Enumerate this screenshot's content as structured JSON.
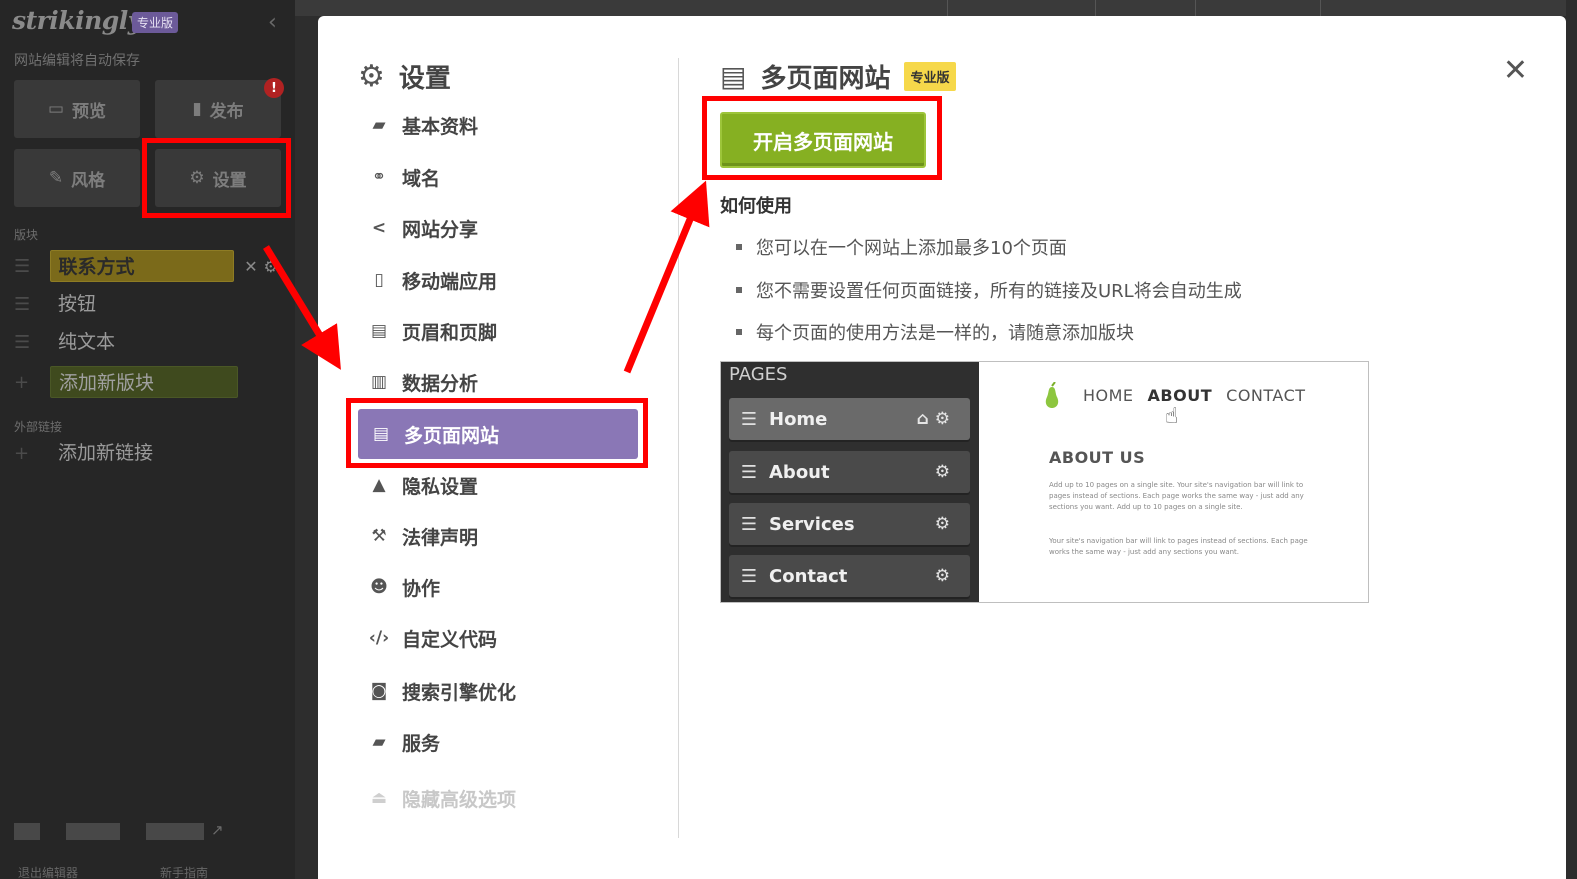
{
  "sidebar": {
    "logo": "strikingly",
    "pro_badge": "专业版",
    "autosave": "网站编辑将自动保存",
    "buttons": {
      "preview": "预览",
      "publish": "发布",
      "style": "风格",
      "settings": "设置"
    },
    "publish_alert": "!",
    "sections": {
      "blocks": "版块",
      "external_links": "外部链接"
    },
    "blocks": [
      "联系方式",
      "按钮",
      "纯文本"
    ],
    "add_block": "添加新版块",
    "add_link": "添加新链接",
    "footer": {
      "exit_editor": "退出编辑器",
      "guide": "新手指南"
    }
  },
  "modal": {
    "nav_title": "设置",
    "nav_items": [
      {
        "label": "基本资料",
        "icon": "briefcase-icon"
      },
      {
        "label": "域名",
        "icon": "link-icon"
      },
      {
        "label": "网站分享",
        "icon": "share-icon"
      },
      {
        "label": "移动端应用",
        "icon": "mobile-icon"
      },
      {
        "label": "页眉和页脚",
        "icon": "header-footer-icon"
      },
      {
        "label": "数据分析",
        "icon": "bar-chart-icon"
      },
      {
        "label": "多页面网站",
        "icon": "pages-icon"
      },
      {
        "label": "隐私设置",
        "icon": "lock-icon"
      },
      {
        "label": "法律声明",
        "icon": "gavel-icon"
      },
      {
        "label": "协作",
        "icon": "users-icon"
      },
      {
        "label": "自定义代码",
        "icon": "code-icon"
      },
      {
        "label": "搜索引擎优化",
        "icon": "search-doc-icon"
      },
      {
        "label": "服务",
        "icon": "folder-user-icon"
      },
      {
        "label": "隐藏高级选项",
        "icon": "eject-icon"
      }
    ],
    "content": {
      "title": "多页面网站",
      "pro_badge": "专业版",
      "enable_button": "开启多页面网站",
      "howto_heading": "如何使用",
      "tips": [
        "您可以在一个网站上添加最多10个页面",
        "您不需要设置任何页面链接，所有的链接及URL将会自动生成",
        "每个页面的使用方法是一样的，请随意添加版块"
      ],
      "illustration": {
        "pages_label": "PAGES",
        "pages": [
          "Home",
          "About",
          "Services",
          "Contact"
        ],
        "site_nav": [
          "HOME",
          "ABOUT",
          "CONTACT"
        ],
        "about_heading": "ABOUT US",
        "para1": "Add up to 10 pages on a single site. Your site's navigation bar will link to pages instead of sections. Each page works the same way - just add any sections you want. Add up to 10 pages on a single site.",
        "para2": "Your site's navigation bar will link to pages instead of sections. Each page works the same way - just add any sections you want."
      }
    }
  },
  "colors": {
    "active_nav": "#8a77b6",
    "enable_button": "#86b022",
    "pro_badge": "#f6d84a",
    "annotation": "#ff0000"
  }
}
